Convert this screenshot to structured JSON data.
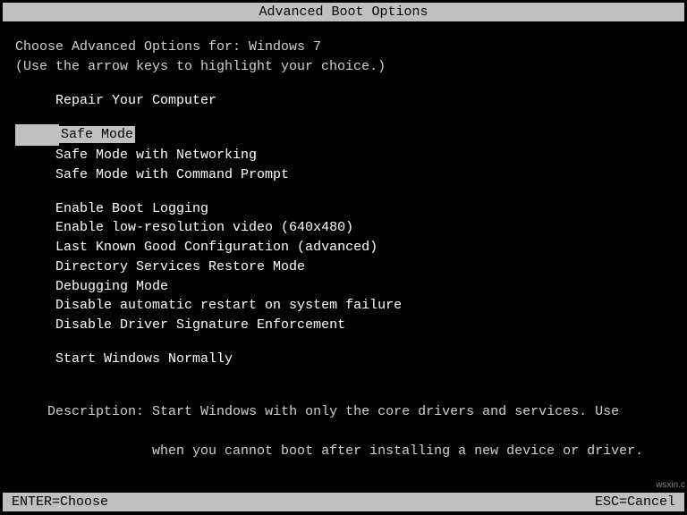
{
  "title": "Advanced Boot Options",
  "instruction_line1": "Choose Advanced Options for: Windows 7",
  "instruction_line2": "(Use the arrow keys to highlight your choice.)",
  "indent": "     ",
  "groups": [
    {
      "items": [
        {
          "label": "Repair Your Computer",
          "selected": false
        }
      ]
    },
    {
      "items": [
        {
          "label": "Safe Mode",
          "selected": true
        },
        {
          "label": "Safe Mode with Networking",
          "selected": false
        },
        {
          "label": "Safe Mode with Command Prompt",
          "selected": false
        }
      ]
    },
    {
      "items": [
        {
          "label": "Enable Boot Logging",
          "selected": false
        },
        {
          "label": "Enable low-resolution video (640x480)",
          "selected": false
        },
        {
          "label": "Last Known Good Configuration (advanced)",
          "selected": false
        },
        {
          "label": "Directory Services Restore Mode",
          "selected": false
        },
        {
          "label": "Debugging Mode",
          "selected": false
        },
        {
          "label": "Disable automatic restart on system failure",
          "selected": false
        },
        {
          "label": "Disable Driver Signature Enforcement",
          "selected": false
        }
      ]
    },
    {
      "items": [
        {
          "label": "Start Windows Normally",
          "selected": false
        }
      ]
    }
  ],
  "description_label": "Description: ",
  "description_text1": "Start Windows with only the core drivers and services. Use",
  "description_text2": "             when you cannot boot after installing a new device or driver.",
  "footer_left": "ENTER=Choose",
  "footer_right": "ESC=Cancel",
  "watermark": "wsxin.c"
}
